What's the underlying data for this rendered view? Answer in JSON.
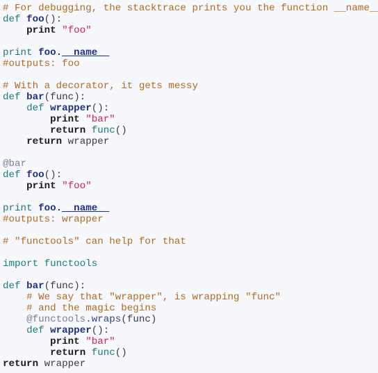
{
  "document": {
    "kind": "source-code-listing",
    "language": "Python",
    "background_color": "#f7f8fb",
    "line_count": 33
  },
  "theme": {
    "comment_color": "#b26a22",
    "keyword_color": "#1c7a82",
    "builtin_bold_color": "#1a1a1a",
    "function_name_color": "#203080",
    "string_color": "#cc2255",
    "decorator_color": "#72849a",
    "plain_color": "#3b3b47"
  },
  "lines": [
    {
      "n": 1,
      "text": "# For debugging, the stacktrace prints you the function __name__"
    },
    {
      "n": 2,
      "text": "def foo():"
    },
    {
      "n": 3,
      "text": "    print \"foo\""
    },
    {
      "n": 4,
      "text": ""
    },
    {
      "n": 5,
      "text": "print foo.__name__"
    },
    {
      "n": 6,
      "text": "#outputs: foo"
    },
    {
      "n": 7,
      "text": ""
    },
    {
      "n": 8,
      "text": "# With a decorator, it gets messy"
    },
    {
      "n": 9,
      "text": "def bar(func):"
    },
    {
      "n": 10,
      "text": "    def wrapper():"
    },
    {
      "n": 11,
      "text": "        print \"bar\""
    },
    {
      "n": 12,
      "text": "        return func()"
    },
    {
      "n": 13,
      "text": "    return wrapper"
    },
    {
      "n": 14,
      "text": ""
    },
    {
      "n": 15,
      "text": "@bar"
    },
    {
      "n": 16,
      "text": "def foo():"
    },
    {
      "n": 17,
      "text": "    print \"foo\""
    },
    {
      "n": 18,
      "text": ""
    },
    {
      "n": 19,
      "text": "print foo.__name__"
    },
    {
      "n": 20,
      "text": "#outputs: wrapper"
    },
    {
      "n": 21,
      "text": ""
    },
    {
      "n": 22,
      "text": "# \"functools\" can help for that"
    },
    {
      "n": 23,
      "text": ""
    },
    {
      "n": 24,
      "text": "import functools"
    },
    {
      "n": 25,
      "text": ""
    },
    {
      "n": 26,
      "text": "def bar(func):"
    },
    {
      "n": 27,
      "text": "    # We say that \"wrapper\", is wrapping \"func\""
    },
    {
      "n": 28,
      "text": "    # and the magic begins"
    },
    {
      "n": 29,
      "text": "    @functools.wraps(func)"
    },
    {
      "n": 30,
      "text": "    def wrapper():"
    },
    {
      "n": 31,
      "text": "        print \"bar\""
    },
    {
      "n": 32,
      "text": "        return func()"
    },
    {
      "n": 33,
      "text": "return wrapper"
    }
  ],
  "tokens": {
    "l1": {
      "comment": "# For debugging, the stacktrace prints you the function __name__"
    },
    "l2": {
      "kw": "def",
      "sp": " ",
      "fn": "foo",
      "rest": "():"
    },
    "l3": {
      "indent": "    ",
      "kw": "print",
      "sp": " ",
      "str": "\"foo\""
    },
    "l5": {
      "kw": "print",
      "sp": " ",
      "obj": "foo",
      "dot": ".",
      "name": "__name__"
    },
    "l6": {
      "comment": "#outputs: foo"
    },
    "l8": {
      "comment": "# With a decorator, it gets messy"
    },
    "l9": {
      "kw": "def",
      "sp": " ",
      "fn": "bar",
      "open": "(",
      "arg": "func",
      "close": "):"
    },
    "l10": {
      "indent": "    ",
      "kw": "def",
      "sp": " ",
      "fn": "wrapper",
      "rest": "():"
    },
    "l11": {
      "indent": "        ",
      "kw": "print",
      "sp": " ",
      "str": "\"bar\""
    },
    "l12": {
      "indent": "        ",
      "kw": "return",
      "sp": " ",
      "id": "func",
      "rest": "()"
    },
    "l13": {
      "indent": "    ",
      "kw": "return",
      "sp": " ",
      "var": "wrapper"
    },
    "l15": {
      "dec": "@bar"
    },
    "l16": {
      "kw": "def",
      "sp": " ",
      "fn": "foo",
      "rest": "():"
    },
    "l17": {
      "indent": "    ",
      "kw": "print",
      "sp": " ",
      "str": "\"foo\""
    },
    "l19": {
      "kw": "print",
      "sp": " ",
      "obj": "foo",
      "dot": ".",
      "name": "__name__"
    },
    "l20": {
      "comment": "#outputs: wrapper"
    },
    "l22": {
      "comment": "# \"functools\" can help for that"
    },
    "l24": {
      "kw": "import",
      "sp": " ",
      "id": "functools"
    },
    "l26": {
      "kw": "def",
      "sp": " ",
      "fn": "bar",
      "open": "(",
      "arg": "func",
      "close": "):"
    },
    "l27": {
      "indent": "    ",
      "comment": "# We say that \"wrapper\", is wrapping \"func\""
    },
    "l28": {
      "indent": "    ",
      "comment": "# and the magic begins"
    },
    "l29": {
      "indent": "    ",
      "decmod": "@functools",
      "decatt": ".wraps",
      "rest": "(func)"
    },
    "l30": {
      "indent": "    ",
      "kw": "def",
      "sp": " ",
      "fn": "wrapper",
      "rest": "():"
    },
    "l31": {
      "indent": "        ",
      "kw": "print",
      "sp": " ",
      "str": "\"bar\""
    },
    "l32": {
      "indent": "        ",
      "kw": "return",
      "sp": " ",
      "id": "func",
      "rest": "()"
    },
    "l33": {
      "kw": "return",
      "sp": " ",
      "var": "wrapper"
    }
  }
}
